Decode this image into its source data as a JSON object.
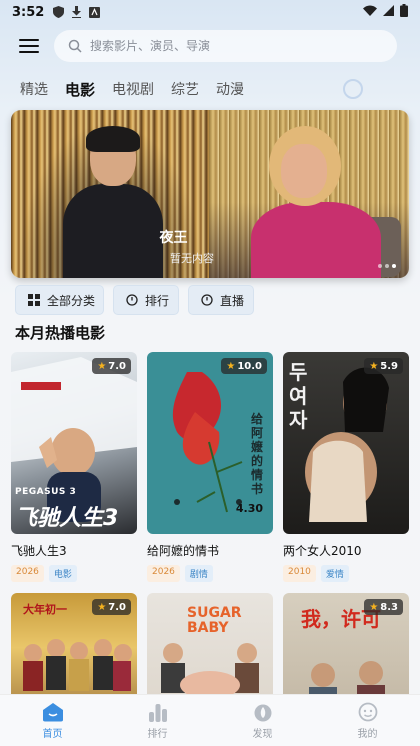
{
  "status_bar": {
    "time": "3:52"
  },
  "search": {
    "placeholder": "搜索影片、演员、导演"
  },
  "tabs": [
    {
      "label": "精选"
    },
    {
      "label": "电影"
    },
    {
      "label": "电视剧"
    },
    {
      "label": "综艺"
    },
    {
      "label": "动漫"
    }
  ],
  "active_tab": "电影",
  "banner": {
    "title": "夜王",
    "subtitle": "暂无内容"
  },
  "quick_actions": [
    {
      "label": "全部分类",
      "icon": "grid-icon"
    },
    {
      "label": "排行",
      "icon": "clock-icon"
    },
    {
      "label": "直播",
      "icon": "clock-icon"
    }
  ],
  "section": {
    "title": "本月热播电影"
  },
  "movies": [
    {
      "title": "飞驰人生3",
      "rating": "7.0",
      "year": "2026",
      "genre": "电影",
      "poster_text": "飞驰人生3"
    },
    {
      "title": "给阿嬷的情书",
      "rating": "10.0",
      "year": "2026",
      "genre": "剧情",
      "poster_text": "给阿嬷的情书",
      "poster_date": "4.30"
    },
    {
      "title": "两个女人2010",
      "rating": "5.9",
      "year": "2010",
      "genre": "爱情",
      "poster_text": "두여자"
    },
    {
      "title": "",
      "rating": "7.0",
      "poster_text": "大年初一"
    },
    {
      "title": "",
      "rating": "",
      "poster_text": "SUGAR BABY"
    },
    {
      "title": "",
      "rating": "8.3",
      "poster_text": "我，许可"
    }
  ],
  "bottom_nav": [
    {
      "label": "首页",
      "icon": "home-icon"
    },
    {
      "label": "排行",
      "icon": "rank-icon"
    },
    {
      "label": "发现",
      "icon": "discover-icon"
    },
    {
      "label": "我的",
      "icon": "profile-icon"
    }
  ],
  "colors": {
    "accent": "#3b8ee0",
    "rating_star": "#f5b21f",
    "year_tag": "#d98a3a",
    "genre_tag": "#3d86c6"
  }
}
